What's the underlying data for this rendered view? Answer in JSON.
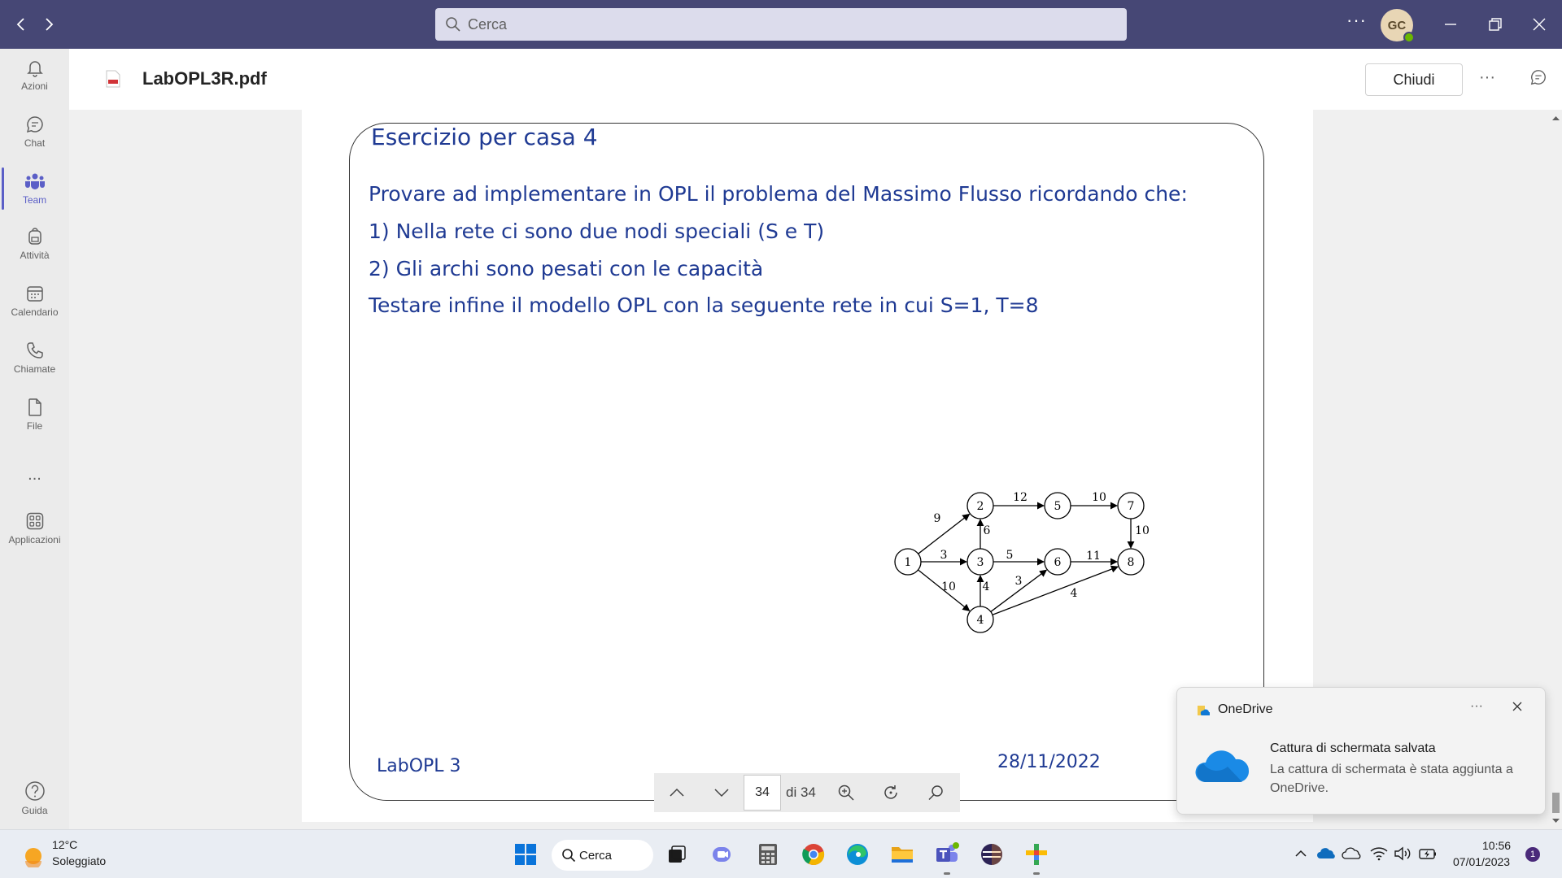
{
  "titlebar": {
    "search_placeholder": "Cerca",
    "more_icon": "ellipsis-icon",
    "avatar_initials": "GC"
  },
  "rail": {
    "items": [
      {
        "label": "Azioni",
        "icon": "bell-icon"
      },
      {
        "label": "Chat",
        "icon": "chat-icon"
      },
      {
        "label": "Team",
        "icon": "teams-icon",
        "active": true
      },
      {
        "label": "Attività",
        "icon": "backpack-icon"
      },
      {
        "label": "Calendario",
        "icon": "calendar-icon"
      },
      {
        "label": "Chiamate",
        "icon": "phone-icon"
      },
      {
        "label": "File",
        "icon": "file-icon"
      },
      {
        "label": "...",
        "icon": "more-icon"
      },
      {
        "label": "Applicazioni",
        "icon": "apps-icon"
      }
    ],
    "help_label": "Guida"
  },
  "file": {
    "name": "LabOPL3R.pdf",
    "close_label": "Chiudi"
  },
  "slide": {
    "title": "Esercizio per casa 4",
    "lines": [
      "Provare ad implementare in OPL il problema del Massimo Flusso ricordando che:",
      "1)   Nella rete ci sono due nodi speciali (S e T)",
      "2)   Gli archi sono pesati con le capacità",
      "Testare infine il modello OPL con la seguente rete in cui S=1, T=8"
    ],
    "footer_left": "LabOPL 3",
    "footer_date": "28/11/2022",
    "graph": {
      "nodes": [
        "1",
        "2",
        "3",
        "4",
        "5",
        "6",
        "7",
        "8"
      ],
      "edges": [
        {
          "from": "1",
          "to": "2",
          "capacity": "9"
        },
        {
          "from": "1",
          "to": "3",
          "capacity": "3"
        },
        {
          "from": "1",
          "to": "4",
          "capacity": "10"
        },
        {
          "from": "3",
          "to": "2",
          "capacity": "6"
        },
        {
          "from": "4",
          "to": "3",
          "capacity": "4"
        },
        {
          "from": "2",
          "to": "5",
          "capacity": "12"
        },
        {
          "from": "3",
          "to": "6",
          "capacity": "5"
        },
        {
          "from": "4",
          "to": "6",
          "capacity": "3"
        },
        {
          "from": "4",
          "to": "8",
          "capacity": "4"
        },
        {
          "from": "5",
          "to": "7",
          "capacity": "10"
        },
        {
          "from": "6",
          "to": "8",
          "capacity": "11"
        },
        {
          "from": "7",
          "to": "8",
          "capacity": "10"
        }
      ]
    }
  },
  "pdf_toolbar": {
    "current_page": "34",
    "total_label": "di 34"
  },
  "toast": {
    "app_name": "OneDrive",
    "more": "···",
    "title": "Cattura di schermata salvata",
    "body": "La cattura di schermata è stata aggiunta a OneDrive."
  },
  "taskbar": {
    "weather_temp": "12°C",
    "weather_desc": "Soleggiato",
    "search_label": "Cerca",
    "time": "10:56",
    "date": "07/01/2023",
    "notification_count": "1"
  }
}
